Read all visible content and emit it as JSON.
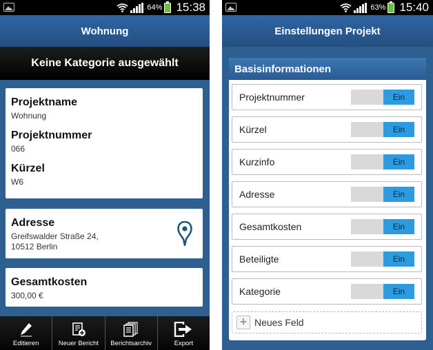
{
  "left": {
    "status": {
      "battery": "64%",
      "time": "15:38"
    },
    "title": "Wohnung",
    "category": "Keine Kategorie ausgewählt",
    "project": {
      "name_label": "Projektname",
      "name_value": "Wohnung",
      "number_label": "Projektnummer",
      "number_value": "066",
      "short_label": "Kürzel",
      "short_value": "W6"
    },
    "address": {
      "label": "Adresse",
      "value": "Greifswalder Straße  24,\n10512 Berlin",
      "icon": "map-pin-icon"
    },
    "costs": {
      "label": "Gesamtkosten",
      "value": "300,00 €"
    },
    "bottom_bar": [
      {
        "label": "Editieren",
        "icon": "pencil-icon"
      },
      {
        "label": "Neuer Bericht",
        "icon": "new-report-icon"
      },
      {
        "label": "Berichtsarchiv",
        "icon": "report-archive-icon"
      },
      {
        "label": "Export",
        "icon": "export-icon"
      }
    ]
  },
  "right": {
    "status": {
      "battery": "63%",
      "time": "15:40"
    },
    "title": "Einstellungen Projekt",
    "section_title": "Basisinformationen",
    "settings": [
      {
        "label": "Projektnummer",
        "state": "Ein"
      },
      {
        "label": "Kürzel",
        "state": "Ein"
      },
      {
        "label": "Kurzinfo",
        "state": "Ein"
      },
      {
        "label": "Adresse",
        "state": "Ein"
      },
      {
        "label": "Gesamtkosten",
        "state": "Ein"
      },
      {
        "label": "Beteiligte",
        "state": "Ein"
      },
      {
        "label": "Kategorie",
        "state": "Ein"
      }
    ],
    "new_field_label": "Neues Feld"
  },
  "colors": {
    "background": "#2d5f91",
    "title_bar": "#2a5a8f",
    "toggle_on": "#2c9be0",
    "pin": "#1f5677"
  }
}
